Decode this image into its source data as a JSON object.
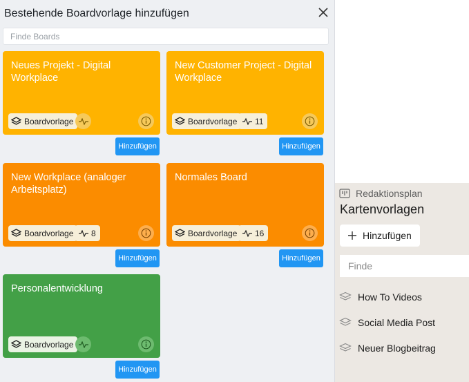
{
  "modal": {
    "title": "Bestehende Boardvorlage hinzufügen",
    "search_placeholder": "Finde Boards",
    "add_label": "Hinzufügen",
    "template_label": "Boardvorlage",
    "boards": [
      {
        "title": "Neues Projekt - Digital Workplace",
        "activity": "",
        "color": "#ffb300"
      },
      {
        "title": "New Customer Project - Digital Workplace",
        "activity": "11",
        "color": "#ffb300"
      },
      {
        "title": "New Workplace (analoger Arbeitsplatz)",
        "activity": "8",
        "color": "#fb8c00"
      },
      {
        "title": "Normales Board",
        "activity": "16",
        "color": "#fb8c00"
      },
      {
        "title": "Personalentwicklung",
        "activity": "",
        "color": "#43a047"
      }
    ]
  },
  "side_panel": {
    "board_name": "Redaktionsplan",
    "title": "Kartenvorlagen",
    "add_label": "Hinzufügen",
    "search_placeholder": "Finde",
    "items": [
      "How To Videos",
      "Social Media Post",
      "Neuer Blogbeitrag"
    ]
  },
  "icons": {
    "close": "close-icon",
    "layers": "layers-icon",
    "activity": "activity-icon",
    "info": "info-icon",
    "plus": "plus-icon",
    "board": "board-icon"
  }
}
